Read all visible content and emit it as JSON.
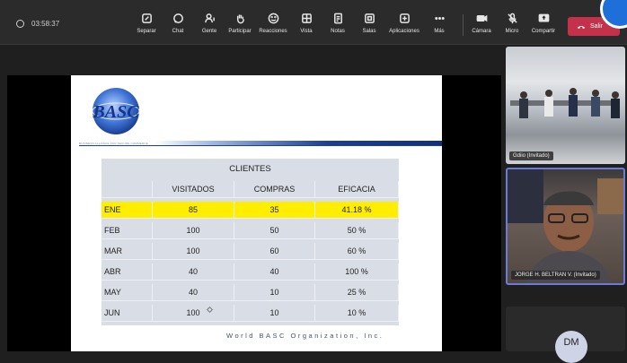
{
  "meeting": {
    "timer": "03:58:37"
  },
  "toolbar": {
    "items": [
      {
        "label": "Separar",
        "icon": "separate-icon"
      },
      {
        "label": "Chat",
        "icon": "chat-icon"
      },
      {
        "label": "Gente",
        "icon": "people-icon"
      },
      {
        "label": "Participar",
        "icon": "raise-hand-icon"
      },
      {
        "label": "Reacciones",
        "icon": "smile-icon"
      },
      {
        "label": "Vista",
        "icon": "view-icon"
      },
      {
        "label": "Notas",
        "icon": "notes-icon"
      },
      {
        "label": "Salas",
        "icon": "rooms-icon"
      },
      {
        "label": "Aplicaciones",
        "icon": "apps-icon"
      },
      {
        "label": "Más",
        "icon": "more-icon"
      },
      {
        "label": "Cámara",
        "icon": "camera-icon"
      },
      {
        "label": "Micro",
        "icon": "mic-off-icon"
      },
      {
        "label": "Compartir",
        "icon": "share-icon"
      }
    ],
    "leave_label": "Salir",
    "leave_color": "#c4314b"
  },
  "slide": {
    "logo_text": "BASC",
    "logo_caption": "BUSINESS ALLIANCE FOR SECURE COMMERCE",
    "table": {
      "title": "CLIENTES",
      "headers": [
        "",
        "VISITADOS",
        "COMPRAS",
        "EFICACIA"
      ],
      "rows": [
        [
          "ENE",
          "85",
          "35",
          "41.18 %"
        ],
        [
          "FEB",
          "100",
          "50",
          "50 %"
        ],
        [
          "MAR",
          "100",
          "60",
          "60 %"
        ],
        [
          "ABR",
          "40",
          "40",
          "100 %"
        ],
        [
          "MAY",
          "40",
          "10",
          "25 %"
        ],
        [
          "JUN",
          "100",
          "10",
          "10 %"
        ]
      ],
      "highlight_row": "ENE",
      "highlight_color": "#ffee00"
    },
    "footer": "World BASC Organization, Inc."
  },
  "participants": [
    {
      "label": "Gdiio (Invitado)"
    },
    {
      "label": "JORGE H. BELTRAN V. (Invitado)"
    },
    {
      "initials": "DM"
    }
  ]
}
